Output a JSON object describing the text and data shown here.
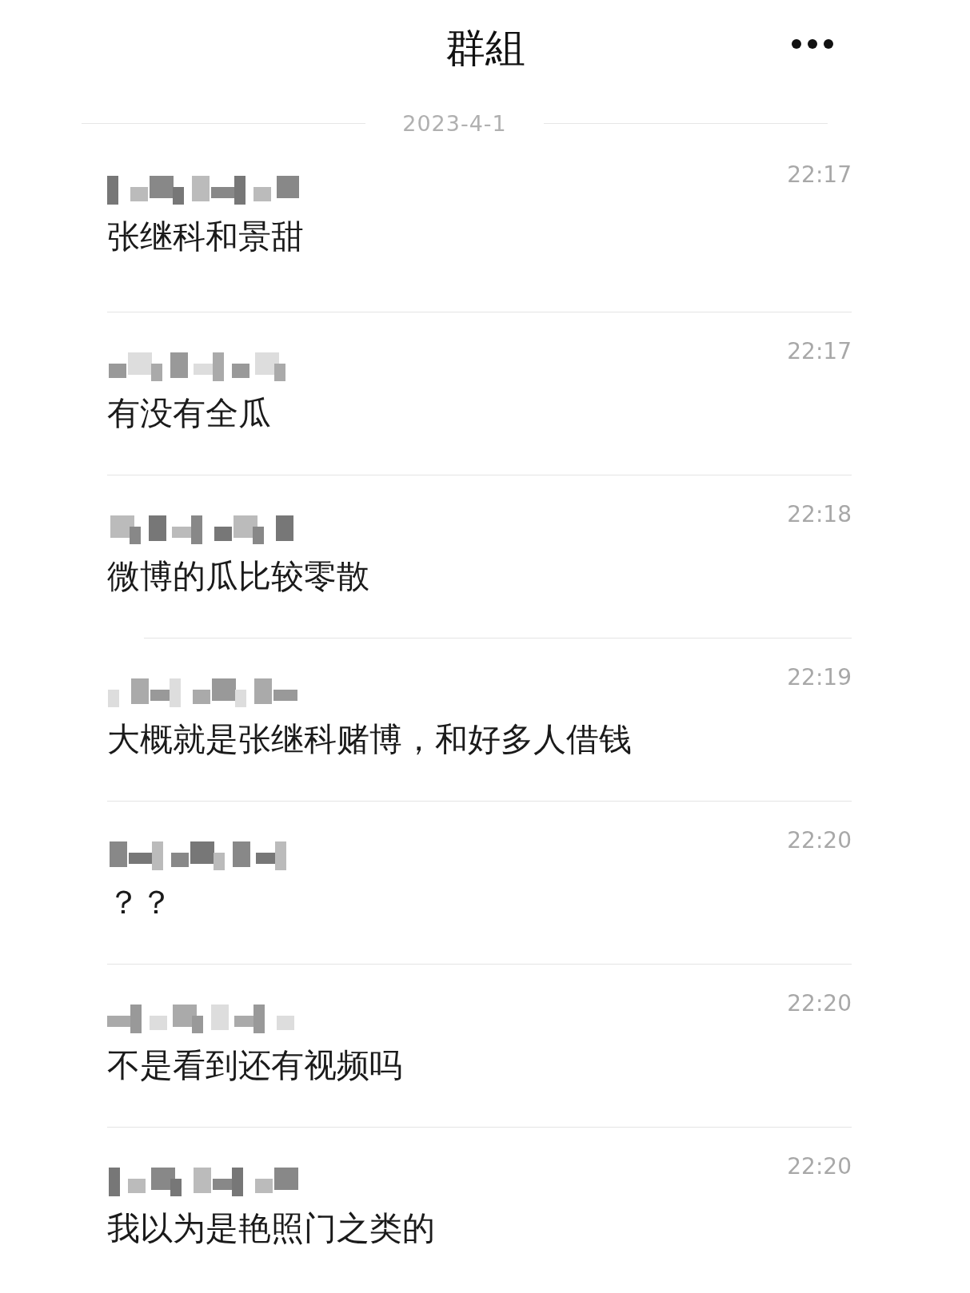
{
  "header": {
    "title": "群組"
  },
  "date_separator": "2023-4-1",
  "messages": [
    {
      "time": "22:17",
      "text": "张继科和景甜"
    },
    {
      "time": "22:17",
      "text": "有没有全瓜"
    },
    {
      "time": "22:18",
      "text": "微博的瓜比较零散"
    },
    {
      "time": "22:19",
      "text": "大概就是张继科赌博，和好多人借钱"
    },
    {
      "time": "22:20",
      "text": "？？"
    },
    {
      "time": "22:20",
      "text": "不是看到还有视频吗"
    },
    {
      "time": "22:20",
      "text": "我以为是艳照门之类的"
    }
  ]
}
